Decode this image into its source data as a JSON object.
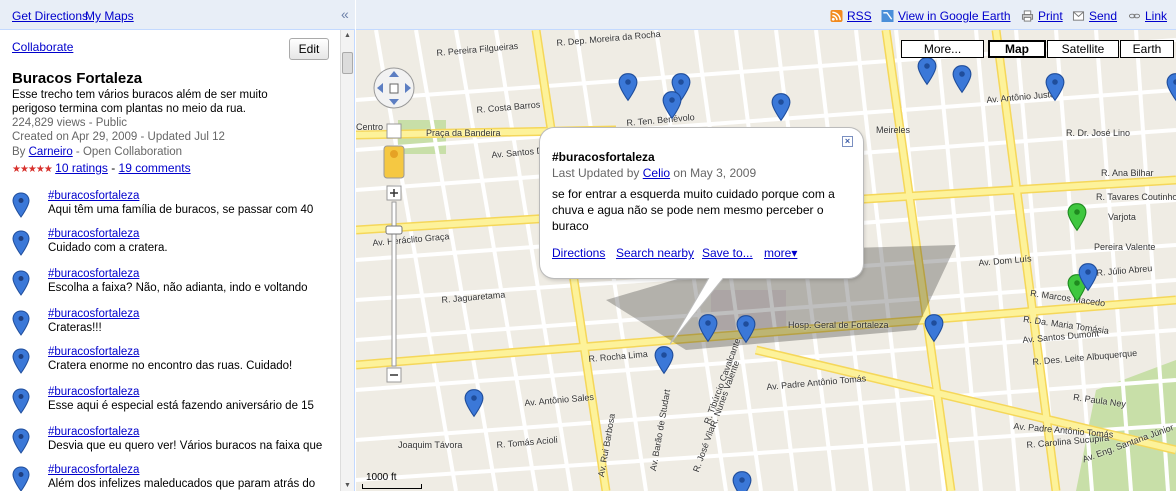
{
  "header": {
    "get_directions": "Get Directions",
    "my_maps": "My Maps",
    "collapse_glyph": "«"
  },
  "panel": {
    "collaborate": "Collaborate",
    "edit": "Edit",
    "title": "Buracos Fortaleza",
    "description": "Esse trecho tem vários buracos além de ser muito perigoso termina com plantas no meio da rua.",
    "views": "224,829 views - Public",
    "created": "Created on Apr 29, 2009 - Updated Jul 12",
    "author_prefix": "By ",
    "author": "Carneiro",
    "author_suffix": " - Open Collaboration",
    "stars": "★★★★★",
    "ratings": "10 ratings",
    "ratings_sep": " - ",
    "comments": "19 comments",
    "items": [
      {
        "title": "#buracosfortaleza",
        "text": "Aqui têm uma família de buracos, se passar com 40"
      },
      {
        "title": "#buracosfortaleza",
        "text": "Cuidado com a cratera."
      },
      {
        "title": "#buracosfortaleza",
        "text": "Escolha a faixa? Não, não adianta, indo e voltando"
      },
      {
        "title": "#buracosfortaleza",
        "text": "Crateras!!!"
      },
      {
        "title": "#buracosfortaleza",
        "text": "Cratera enorme no encontro das ruas. Cuidado!"
      },
      {
        "title": "#buracosfortaleza",
        "text": "Esse aqui é especial está fazendo aniversário de 15"
      },
      {
        "title": "#buracosfortaleza",
        "text": "Desvia que eu quero ver! Vários buracos na faixa que"
      },
      {
        "title": "#buracosfortaleza",
        "text": "Além dos infelizes maleducados que param atrás do"
      }
    ]
  },
  "maptoolbar": {
    "rss": "RSS",
    "earth": "View in Google Earth",
    "print": "Print",
    "send": "Send",
    "link": "Link"
  },
  "maptypes": {
    "more": "More...",
    "map": "Map",
    "satellite": "Satellite",
    "earth": "Earth",
    "selected": "Map"
  },
  "bubble": {
    "title": "#buracosfortaleza",
    "updated_prefix": "Last Updated by ",
    "updated_user": "Celio",
    "updated_suffix": " on May 3, 2009",
    "body": "se for entrar a esquerda muito cuidado porque com a chuva e agua não se pode nem mesmo perceber o buraco",
    "directions": "Directions",
    "search_nearby": "Search nearby",
    "save_to": "Save to...",
    "more": "more▾",
    "close": "×"
  },
  "scale": "1000 ft",
  "street_labels": [
    "R. Dep. Moreira da Rocha",
    "R. Pereira Filgueiras",
    "R. Costa Barros",
    "Av. Santos Dumont",
    "R. Ten. Benévolo",
    "Meireles",
    "R. Dr. José Lino",
    "Av. Antônio Justa",
    "R. Ana Bilhar",
    "R. Tavares Coutinho",
    "Varjota",
    "Pereira Valente",
    "Av. Dom Luís",
    "R. Júlio Abreu",
    "R. Marcos Macedo",
    "R. Da. Maria Tomásia",
    "Av. Santos Dumont",
    "R. Des. Leite Albuquerque",
    "R. Paula Ney",
    "Av. Padre Antônio Tomás",
    "R. Carolina Sucupira",
    "Av. Eng. Santana Júnior",
    "Av. Heráclito Graça",
    "R. Jaguaretama",
    "R. Rocha Lima",
    "Hosp. Geral de Fortaleza",
    "Av. Padre Antônio Tomás",
    "Av. Antônio Sales",
    "R. Tomás Acioli",
    "R. José Vilar",
    "R. Nunes Valente",
    "Av. Rui Barbosa",
    "Av. Barão de Studart",
    "R. Tibúrcio Cavalcante",
    "Joaquim Távora",
    "Praça da Bandeira",
    "Centro"
  ],
  "colors": {
    "link": "#0000cc",
    "topbar_bg": "#e8eef7",
    "pin_blue": "#3b78d8",
    "pin_green": "#3fc73f",
    "road_yellow": "#fdf29a",
    "map_bg": "#efece4"
  }
}
